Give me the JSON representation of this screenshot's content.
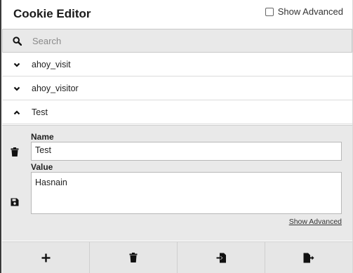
{
  "header": {
    "title": "Cookie Editor",
    "show_advanced_label": "Show Advanced"
  },
  "search": {
    "placeholder": "Search"
  },
  "cookies": [
    {
      "name": "ahoy_visit",
      "expanded": false
    },
    {
      "name": "ahoy_visitor",
      "expanded": false
    },
    {
      "name": "Test",
      "expanded": true
    }
  ],
  "editor": {
    "name_label": "Name",
    "name_value": "Test",
    "value_label": "Value",
    "value_value": "Hasnain",
    "show_advanced_link": "Show Advanced"
  },
  "toolbar": {
    "buttons": [
      "add-icon",
      "delete-all-icon",
      "import-icon",
      "export-icon"
    ]
  }
}
